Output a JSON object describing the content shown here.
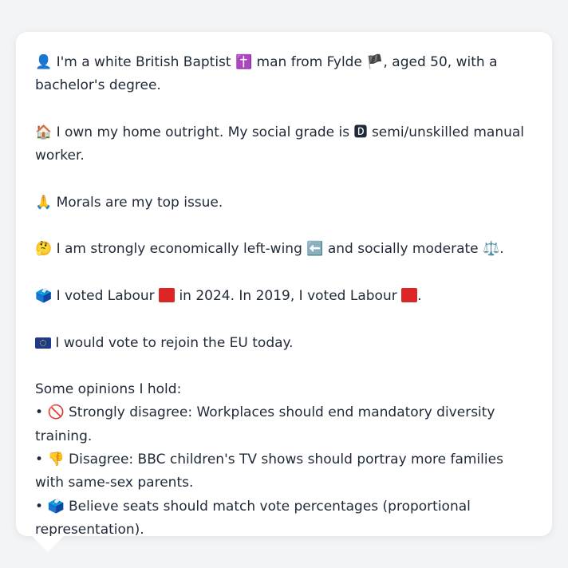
{
  "persona": {
    "identity": {
      "icon": "person-icon",
      "text_a": "I'm a white British Baptist",
      "icon_religion": "latin-cross-icon",
      "text_b": "man from Fylde",
      "icon_nation": "england-flag-icon",
      "text_c": ", aged 50, with a bachelor's degree."
    },
    "housing": {
      "icon": "house-icon",
      "text_a": "I own my home outright. My social grade is",
      "icon_grade": "letter-d-icon",
      "text_b": "semi/unskilled manual worker."
    },
    "issue": {
      "icon": "praying-hands-icon",
      "text": "Morals are my top issue."
    },
    "ideology": {
      "icon": "thinking-face-icon",
      "text_a": "I am strongly economically left-wing",
      "icon_left": "left-arrow-icon",
      "text_b": "and socially moderate",
      "icon_scale": "balance-scale-icon",
      "text_c": "."
    },
    "votes": {
      "icon": "ballot-box-icon",
      "text_a": "I voted Labour",
      "text_b": "in 2024. In 2019, I voted Labour",
      "text_c": ".",
      "party_color": "#dc2626"
    },
    "eu": {
      "icon": "eu-flag-icon",
      "text": "I would vote to rejoin the EU today."
    },
    "opinions": {
      "title": "Some opinions I hold:",
      "items": [
        {
          "bullet": "•",
          "icon": "prohibited-icon",
          "text": "Strongly disagree: Workplaces should end mandatory diversity training."
        },
        {
          "bullet": "•",
          "icon": "thumbs-down-icon",
          "text": "Disagree: BBC children's TV shows should portray more families with same-sex parents."
        },
        {
          "bullet": "•",
          "icon": "ballot-box-icon",
          "text": "Believe seats should match vote percentages (proportional representation)."
        }
      ]
    }
  }
}
